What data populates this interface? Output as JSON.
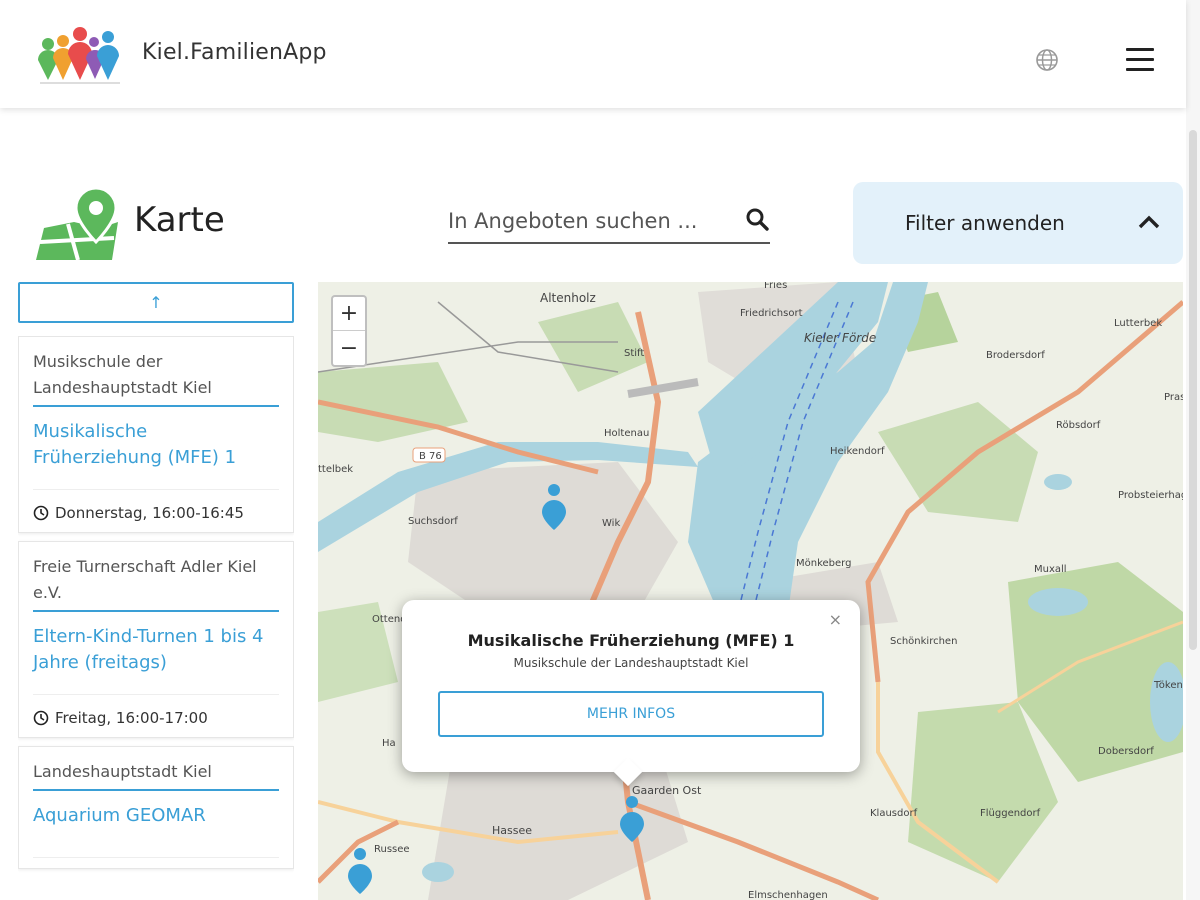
{
  "header": {
    "app_title": "Kiel.FamilienApp"
  },
  "page": {
    "title": "Karte"
  },
  "search": {
    "placeholder": "In Angeboten suchen ..."
  },
  "filter": {
    "label": "Filter anwenden"
  },
  "list": {
    "up_label": "↑",
    "items": [
      {
        "org": "Musikschule der Landeshauptstadt Kiel",
        "title": "Musikalische Früherziehung (MFE) 1",
        "time": "Donnerstag, 16:00-16:45"
      },
      {
        "org": "Freie Turnerschaft Adler Kiel e.V.",
        "title": "Eltern-Kind-Turnen 1 bis 4 Jahre (freitags)",
        "time": "Freitag, 16:00-17:00"
      },
      {
        "org": "Landeshauptstadt Kiel",
        "title": "Aquarium GEOMAR",
        "time": ""
      }
    ]
  },
  "map": {
    "zoom_in": "+",
    "zoom_out": "−",
    "labels": {
      "altenholz": "Altenholz",
      "fries": "Fries",
      "friedrichsort": "Friedrichsort",
      "kieler_foerde": "Kieler Förde",
      "lutterbek": "Lutterbek",
      "brodersdorf": "Brodersdorf",
      "prasdorf": "Prasd",
      "stift": "Stift",
      "holtenau": "Holtenau",
      "heikendorf": "Heikendorf",
      "roebsdorf": "Röbsdorf",
      "b76": "B 76",
      "ottelbek": "ttelbek",
      "suchsdorf": "Suchsdorf",
      "wik": "Wik",
      "probsteierhagen": "Probsteierhagen",
      "moenkeberg": "Mönkeberg",
      "muxall": "Muxall",
      "ottendorf": "Ottend",
      "schoenkirchen": "Schönkirchen",
      "toekendorf": "Tökendor",
      "dobersdorf": "Dobersdorf",
      "gaarden_ost": "Gaarden Ost",
      "klausdorf": "Klausdorf",
      "flueggendorf": "Flüggendorf",
      "hassee": "Hassee",
      "russee": "Russee",
      "elmschenhagen": "Elmschenhagen",
      "ha": "Ha"
    },
    "popup": {
      "title": "Musikalische Früherziehung (MFE) 1",
      "subtitle": "Musikschule der Landeshauptstadt Kiel",
      "button": "MEHR INFOS",
      "close": "×"
    }
  },
  "colors": {
    "accent": "#3a9fd6",
    "filter_bg": "#e3f1fa",
    "water": "#aad3df",
    "forest": "#add19e",
    "karte_icon": "#5cb85c"
  }
}
